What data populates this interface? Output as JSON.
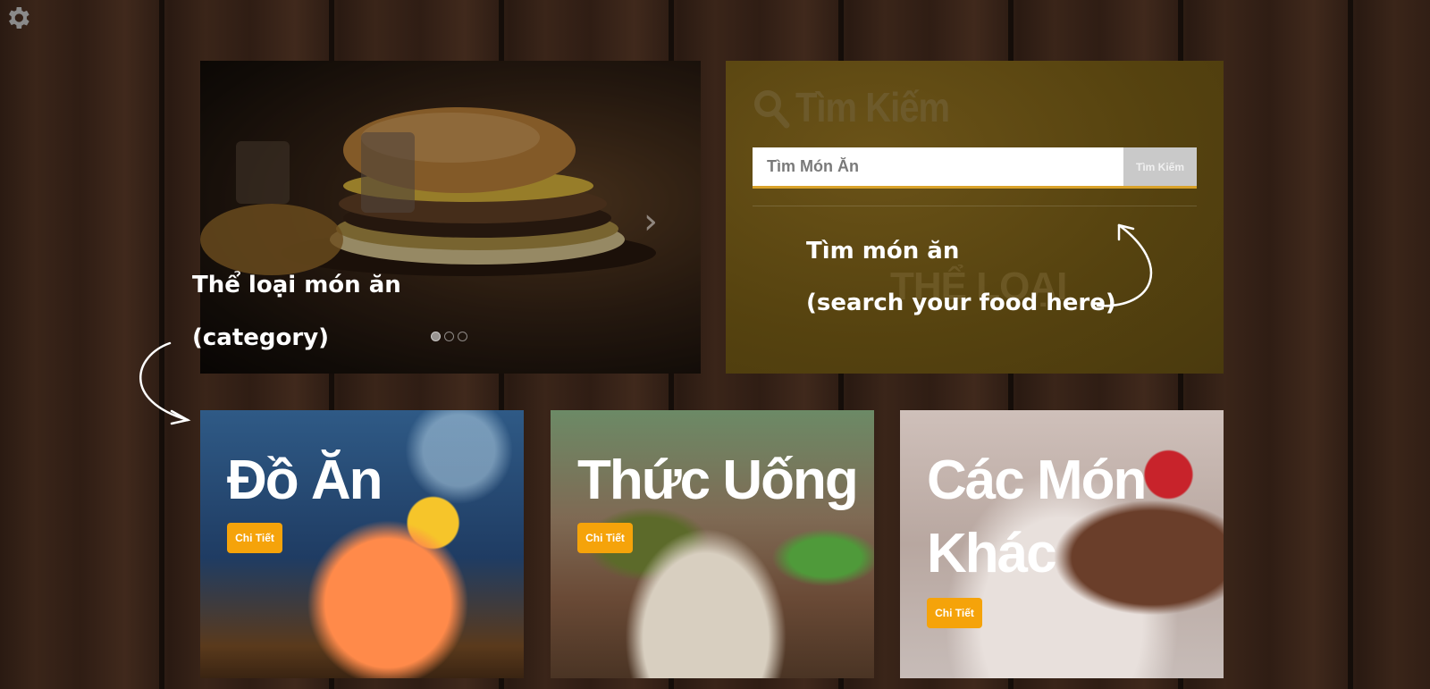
{
  "settings": {
    "icon": "gear-icon"
  },
  "slider": {
    "next_icon": "›",
    "dot_count": 3,
    "active_dot": 0
  },
  "search": {
    "title": "Tìm Kiếm",
    "placeholder": "Tìm Món Ăn",
    "button_label": "Tìm Kiếm",
    "watermark": "THỂ LOẠI"
  },
  "annotations": {
    "category_line1": "Thể loại món ăn",
    "category_line2": "(category)",
    "search_line1": "Tìm món ăn",
    "search_line2": "(search your food here)"
  },
  "categories": [
    {
      "title": "Đồ Ăn",
      "button_label": "Chi Tiết"
    },
    {
      "title": "Thức Uống",
      "button_label": "Chi Tiết"
    },
    {
      "title": "Các Món Khác",
      "button_label": "Chi Tiết"
    }
  ],
  "colors": {
    "accent": "#f5a30a",
    "search_panel": "#5a4512"
  }
}
